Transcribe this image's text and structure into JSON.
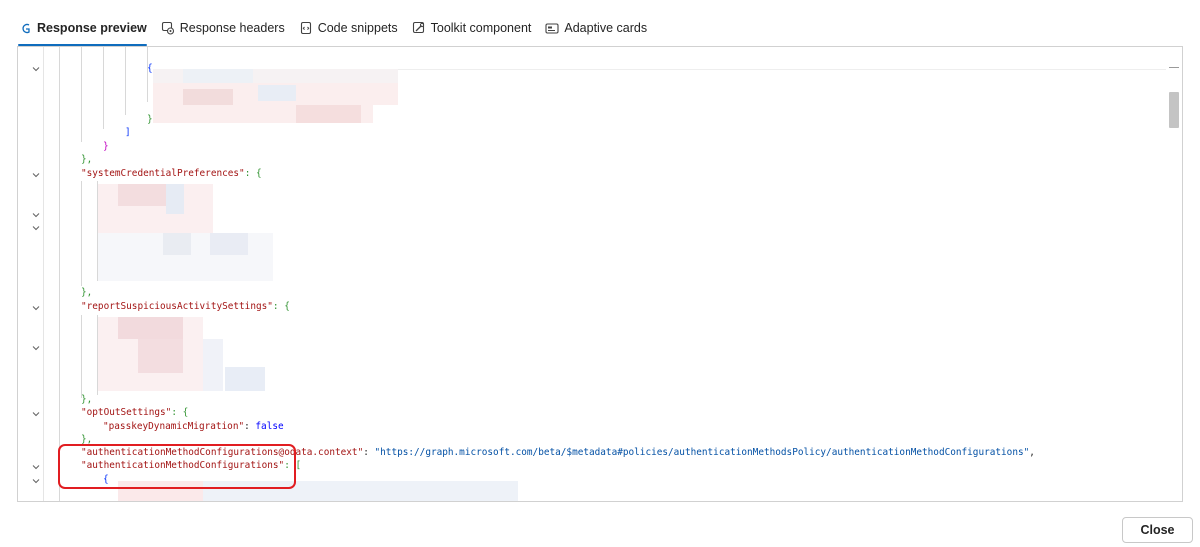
{
  "tabs": [
    {
      "label": "Response preview",
      "icon": "response-preview-icon",
      "active": true
    },
    {
      "label": "Response headers",
      "icon": "response-headers-icon",
      "active": false
    },
    {
      "label": "Code snippets",
      "icon": "code-snippets-icon",
      "active": false
    },
    {
      "label": "Toolkit component",
      "icon": "toolkit-component-icon",
      "active": false
    },
    {
      "label": "Adaptive cards",
      "icon": "adaptive-cards-icon",
      "active": false
    }
  ],
  "code": {
    "l_open_brace": "{",
    "l_close_brace": "}",
    "l_close_bracket": "]",
    "l_close_brace2": "}",
    "l_close_comma1": "},",
    "l_syscred_key": "\"systemCredentialPreferences\"",
    "l_syscred_colon": ": {",
    "l_close_comma2": "},",
    "l_report_key": "\"reportSuspiciousActivitySettings\"",
    "l_report_colon": ": {",
    "l_close_comma3": "},",
    "l_optout_key": "\"optOutSettings\"",
    "l_optout_colon": ": {",
    "l_passkey_key": "\"passkeyDynamicMigration\"",
    "l_passkey_colon": ": ",
    "l_passkey_value": "false",
    "l_close_comma4": "},",
    "l_context_key": "\"authenticationMethodConfigurations@odata.context\"",
    "l_context_colon": ": ",
    "l_context_value": "\"https://graph.microsoft.com/beta/$metadata#policies/authenticationMethodsPolicy/authenticationMethodConfigurations\"",
    "l_context_comma": ",",
    "l_configs_key": "\"authenticationMethodConfigurations\"",
    "l_configs_colon": ": [",
    "l_configs_item": "{"
  },
  "footer": {
    "close_label": "Close"
  },
  "colors": {
    "accent": "#0f6cbd",
    "highlight": "#e11d21",
    "json_key": "#a31515",
    "json_string": "#0451a5",
    "json_literal": "#0000ff"
  }
}
